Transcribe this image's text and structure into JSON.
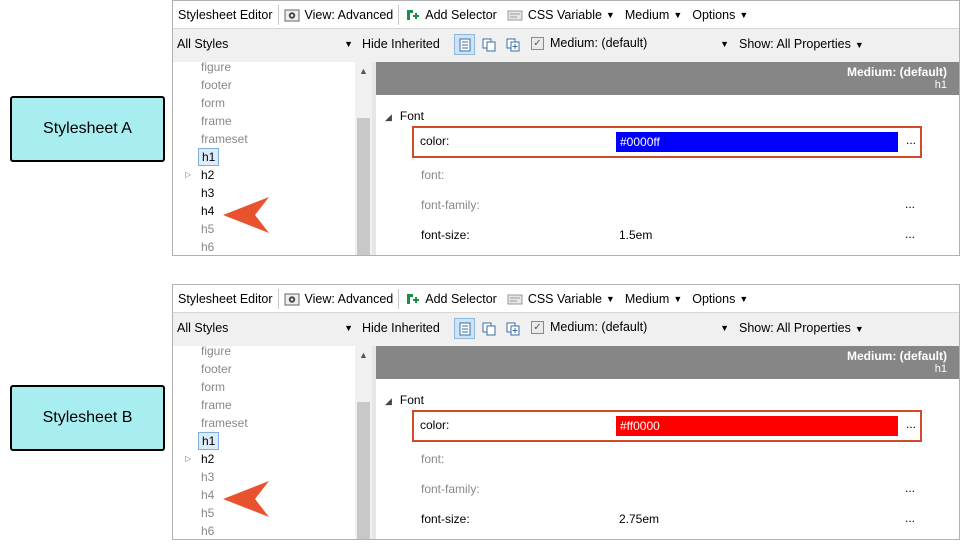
{
  "callouts": {
    "a": "Stylesheet A",
    "b": "Stylesheet B"
  },
  "toolbar": {
    "title": "Stylesheet Editor",
    "view": "View: Advanced",
    "add_selector": "Add Selector",
    "css_variable": "CSS Variable",
    "medium": "Medium",
    "options": "Options"
  },
  "filterbar": {
    "styles_select": "All Styles",
    "hide_inherited": "Hide Inherited",
    "medium_select": "Medium: (default)",
    "show_props": "Show: All Properties"
  },
  "tree": {
    "items": [
      "figure",
      "footer",
      "form",
      "frame",
      "frameset",
      "h1",
      "h2",
      "h3",
      "h4",
      "h5",
      "h6"
    ],
    "selected": "h1"
  },
  "props_header": {
    "medium": "Medium: (default)",
    "selector": "h1"
  },
  "font_group": "Font",
  "prop_names": {
    "color": "color:",
    "font": "font:",
    "font_family": "font-family:",
    "font_size": "font-size:"
  },
  "ellipsis": "...",
  "panel_a": {
    "color_value": "#0000ff",
    "color_hex": "#0000ff",
    "font_size": "1.5em"
  },
  "panel_b": {
    "color_value": "#ff0000",
    "color_hex": "#ff0000",
    "font_size": "2.75em"
  },
  "colors": {
    "callout_fill": "#a8eef0",
    "highlight_border": "#d14a2a",
    "arrow": "#e8522e",
    "header_gray": "#868686"
  },
  "icons": [
    "eye-icon",
    "add-selector-icon",
    "css-variable-icon",
    "view-list-icon",
    "view-copy-icon",
    "view-add-icon",
    "checkbox-icon",
    "chevron-down-icon",
    "arrow-pointer-icon"
  ]
}
